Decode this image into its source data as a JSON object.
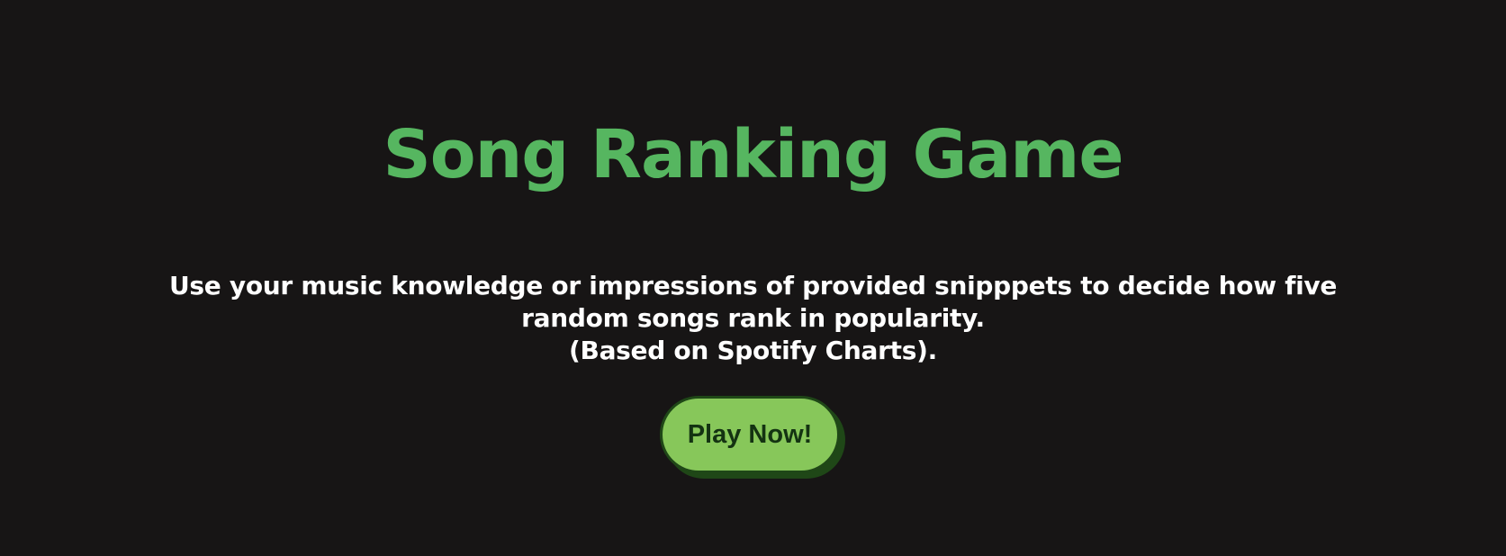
{
  "header": {
    "title": "Song Ranking Game"
  },
  "intro": {
    "line1": "Use your music knowledge or impressions of provided snipppets to decide how five",
    "line2": "random songs rank in popularity.",
    "line3": "(Based on Spotify Charts)."
  },
  "actions": {
    "play_label": "Play Now!"
  },
  "colors": {
    "background": "#171515",
    "title": "#56b660",
    "text": "#ffffff",
    "button_fill": "#87c75a",
    "button_shadow": "#1f4717",
    "button_text": "#143312"
  }
}
